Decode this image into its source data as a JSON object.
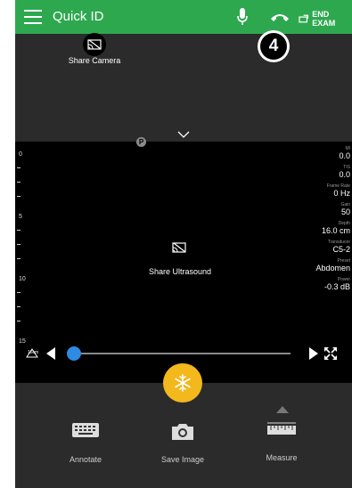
{
  "header": {
    "title": "Quick ID",
    "end_exam_label": "END EXAM",
    "notification_count": "4"
  },
  "camera": {
    "share_label": "Share Camera"
  },
  "ultrasound": {
    "indicator": "P",
    "share_label": "Share Ultrasound",
    "depth_labels": [
      "0",
      "5",
      "10",
      "15"
    ],
    "probe_label": "16cm",
    "params": [
      {
        "label": "MI",
        "value": "0.0"
      },
      {
        "label": "TIS",
        "value": "0.0"
      },
      {
        "label": "Frame Rate",
        "value": "0 Hz"
      },
      {
        "label": "Gain",
        "value": "50"
      },
      {
        "label": "Depth",
        "value": "16.0 cm"
      },
      {
        "label": "Transducer",
        "value": "C5-2"
      },
      {
        "label": "Preset",
        "value": "Abdomen"
      },
      {
        "label": "Power",
        "value": "-0.3 dB"
      }
    ],
    "cine_position": 0.02
  },
  "actions": {
    "annotate_label": "Annotate",
    "save_image_label": "Save Image",
    "measure_label": "Measure"
  },
  "colors": {
    "header_green": "#2ea84f",
    "freeze_yellow": "#f2b81c",
    "slider_blue": "#2f8ae4"
  }
}
